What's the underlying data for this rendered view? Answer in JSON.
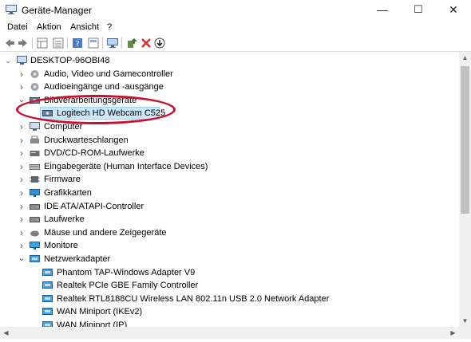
{
  "window": {
    "title": "Geräte-Manager"
  },
  "window_controls": {
    "minimize": "—",
    "maximize": "☐",
    "close": "✕"
  },
  "menu": [
    "Datei",
    "Aktion",
    "Ansicht",
    "?"
  ],
  "toolbar": [
    "back-icon",
    "forward-icon",
    "properties-grid-icon",
    "list-icon",
    "help-icon",
    "details-icon",
    "monitor-icon",
    "update-driver-icon",
    "uninstall-icon",
    "download-icon"
  ],
  "tree": {
    "root": "DESKTOP-96OBI48",
    "categories": [
      {
        "label": "Audio, Video und Gamecontroller",
        "expanded": false
      },
      {
        "label": "Audioeingänge und -ausgänge",
        "expanded": false
      },
      {
        "label": "Bildverarbeitungsgeräte",
        "expanded": true
      },
      {
        "label": "Logitech HD Webcam C525",
        "child": true,
        "selected": true
      },
      {
        "label": "Computer",
        "expanded": false
      },
      {
        "label": "Druckwarteschlangen",
        "expanded": false
      },
      {
        "label": "DVD/CD-ROM-Laufwerke",
        "expanded": false
      },
      {
        "label": "Eingabegeräte (Human Interface Devices)",
        "expanded": false
      },
      {
        "label": "Firmware",
        "expanded": false
      },
      {
        "label": "Grafikkarten",
        "expanded": false
      },
      {
        "label": "IDE ATA/ATAPI-Controller",
        "expanded": false
      },
      {
        "label": "Laufwerke",
        "expanded": false
      },
      {
        "label": "Mäuse und andere Zeigegeräte",
        "expanded": false
      },
      {
        "label": "Monitore",
        "expanded": false
      },
      {
        "label": "Netzwerkadapter",
        "expanded": true
      },
      {
        "label": "Phantom TAP-Windows Adapter V9",
        "child": true
      },
      {
        "label": "Realtek PCIe GBE Family Controller",
        "child": true
      },
      {
        "label": "Realtek RTL8188CU Wireless LAN 802.11n USB 2.0 Network Adapter",
        "child": true
      },
      {
        "label": "WAN Miniport (IKEv2)",
        "child": true
      },
      {
        "label": "WAN Miniport (IP)",
        "child": true
      }
    ]
  },
  "colors": {
    "selection": "#cce8ff",
    "annotation_ellipse": "#c8102e"
  }
}
